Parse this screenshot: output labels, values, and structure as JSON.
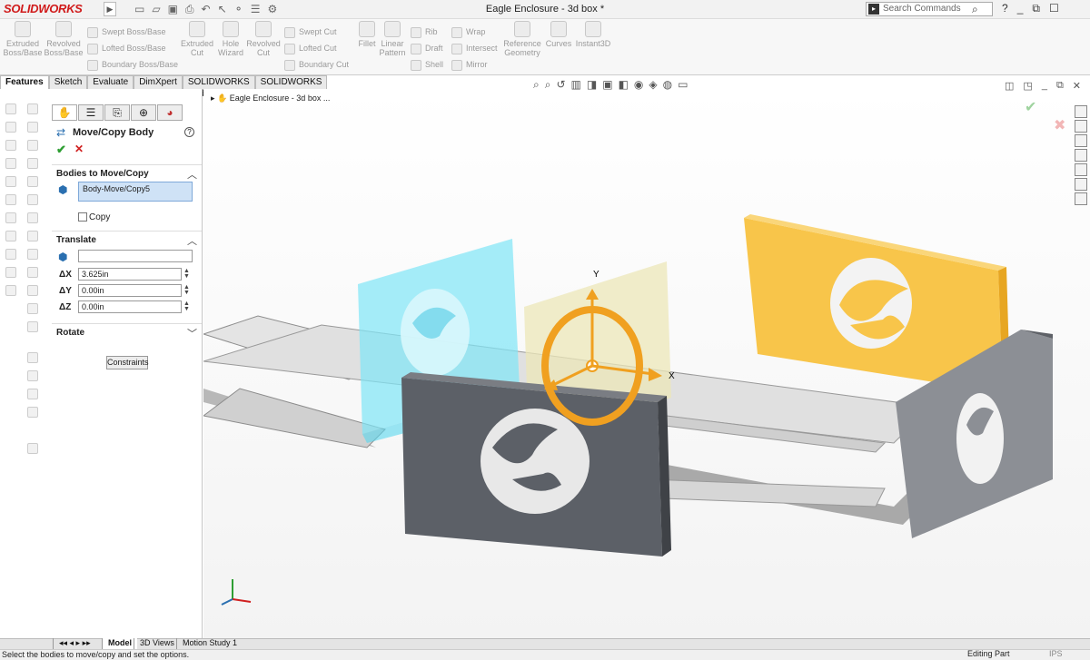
{
  "app": {
    "brand": "SOLIDWORKS",
    "document_title": "Eagle Enclosure - 3d box *"
  },
  "search": {
    "placeholder": "Search Commands"
  },
  "command_manager": {
    "large": [
      {
        "label": "Extruded\nBoss/Base"
      },
      {
        "label": "Revolved\nBoss/Base"
      },
      {
        "label": "Extruded\nCut"
      },
      {
        "label": "Hole\nWizard"
      },
      {
        "label": "Revolved\nCut"
      },
      {
        "label": "Fillet"
      },
      {
        "label": "Linear\nPattern"
      },
      {
        "label": "Reference\nGeometry"
      },
      {
        "label": "Curves"
      },
      {
        "label": "Instant3D"
      }
    ],
    "small": [
      {
        "label": "Swept Boss/Base"
      },
      {
        "label": "Lofted Boss/Base"
      },
      {
        "label": "Boundary Boss/Base"
      },
      {
        "label": "Swept Cut"
      },
      {
        "label": "Lofted Cut"
      },
      {
        "label": "Boundary Cut"
      },
      {
        "label": "Rib"
      },
      {
        "label": "Draft"
      },
      {
        "label": "Shell"
      },
      {
        "label": "Wrap"
      },
      {
        "label": "Intersect"
      },
      {
        "label": "Mirror"
      }
    ]
  },
  "tabs": [
    "Features",
    "Sketch",
    "Evaluate",
    "DimXpert",
    "SOLIDWORKS Add-Ins",
    "SOLIDWORKS MBD"
  ],
  "property_manager": {
    "title": "Move/Copy Body",
    "bodies_section": "Bodies to Move/Copy",
    "selected_body": "Body-Move/Copy5",
    "copy_label": "Copy",
    "copy_checked": false,
    "translate_section": "Translate",
    "dx_label": "ΔX",
    "dx": "3.625in",
    "dy_label": "ΔY",
    "dy": "0.00in",
    "dz_label": "ΔZ",
    "dz": "0.00in",
    "rotate_section": "Rotate",
    "constraints_button": "Constraints"
  },
  "tree": {
    "root": "Eagle Enclosure - 3d box ..."
  },
  "triad": {
    "y": "Y",
    "x": "X"
  },
  "bottom_tabs": [
    "Model",
    "3D Views",
    "Motion Study 1"
  ],
  "status": {
    "message": "Select the bodies to move/copy and set the options.",
    "mode": "Editing Part",
    "units": "IPS"
  },
  "colors": {
    "accent_orange": "#f0a020",
    "selected_cyan": "#6fe0f5",
    "body_gray": "#5b5f66",
    "ok_green": "#2e9e33",
    "cancel_red": "#d02020"
  }
}
